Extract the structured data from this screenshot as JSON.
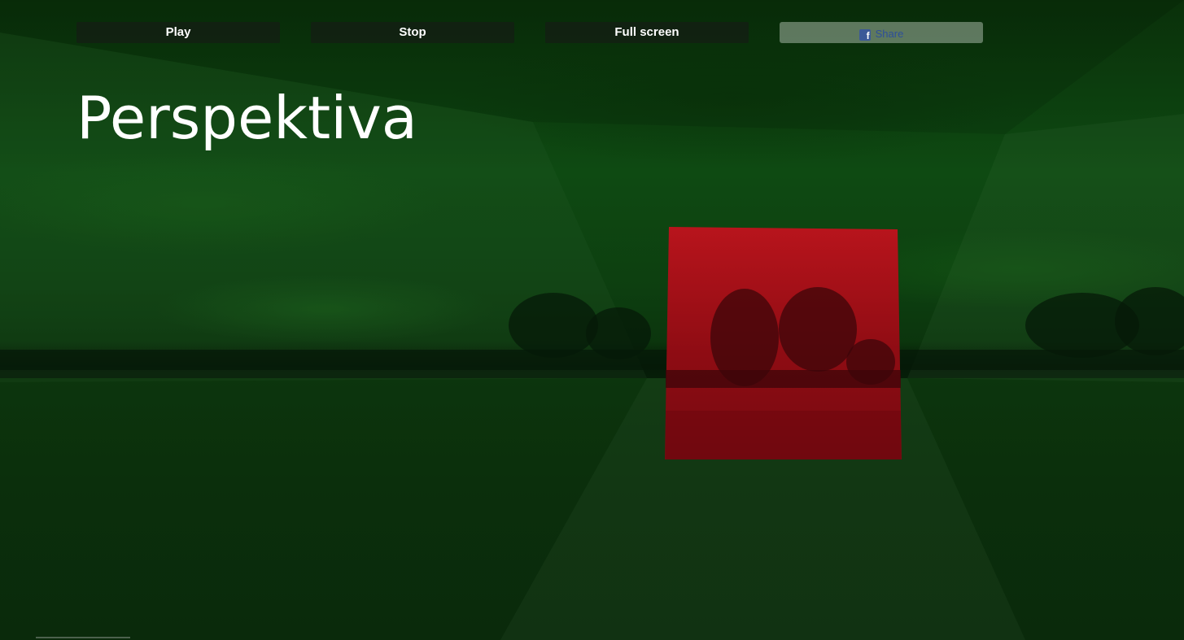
{
  "toolbar": {
    "play_label": "Play",
    "stop_label": "Stop",
    "fullscreen_label": "Full screen",
    "share_label": "Share",
    "share_icon": "facebook-icon"
  },
  "page": {
    "title": "Perspektiva"
  },
  "colors": {
    "scene_tint": "#0e4a12",
    "panel_red": "#a0101a",
    "button_bg": "#141e14",
    "share_text": "#2d4f9a"
  }
}
